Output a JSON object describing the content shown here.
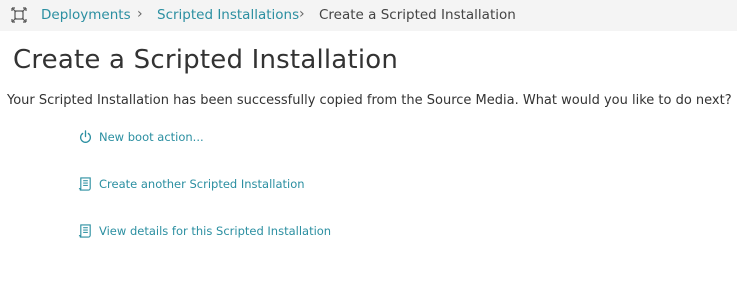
{
  "breadcrumb": {
    "home_icon": "deployments-home-icon",
    "items": [
      {
        "label": "Deployments"
      },
      {
        "label": "Scripted Installations"
      },
      {
        "label": "Create a Scripted Installation"
      }
    ],
    "separator": "›"
  },
  "page": {
    "title": "Create a Scripted Installation",
    "message": "Your Scripted Installation has been successfully copied from the Source Media. What would you like to do next?"
  },
  "actions": [
    {
      "label": "New boot action...",
      "icon": "power-icon"
    },
    {
      "label": "Create another Scripted Installation",
      "icon": "script-document-icon"
    },
    {
      "label": "View details for this Scripted Installation",
      "icon": "script-document-icon"
    }
  ],
  "colors": {
    "link": "#2b8fa1",
    "breadcrumb_bg": "#f4f4f4",
    "text": "#333333"
  }
}
